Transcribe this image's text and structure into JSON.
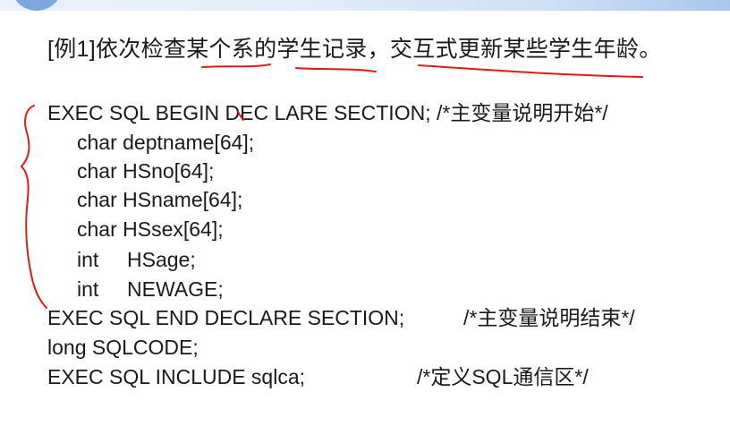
{
  "title": {
    "text": "[例1]依次检查某个系的学生记录，交互式更新某些学生年龄。"
  },
  "code": {
    "line1": "EXEC SQL BEGIN DEC LARE SECTION;  /*主变量说明开始*/",
    "line2": "char deptname[64];",
    "line3": "char HSno[64];",
    "line4": "char HSname[64];",
    "line5": "char HSsex[64];",
    "line6_type": "int",
    "line6_var": "HSage;",
    "line7_type": "int",
    "line7_var": "NEWAGE;",
    "line8_stmt": "EXEC SQL END DECLARE SECTION;",
    "line8_comment": "/*主变量说明结束*/",
    "line9": "long SQLCODE;",
    "line10_stmt": "EXEC SQL INCLUDE sqlca;",
    "line10_comment": "/*定义SQL通信区*/"
  },
  "colors": {
    "annotation": "#e01a1a",
    "text": "#1a1a1a",
    "accent": "#7ea6e0"
  }
}
